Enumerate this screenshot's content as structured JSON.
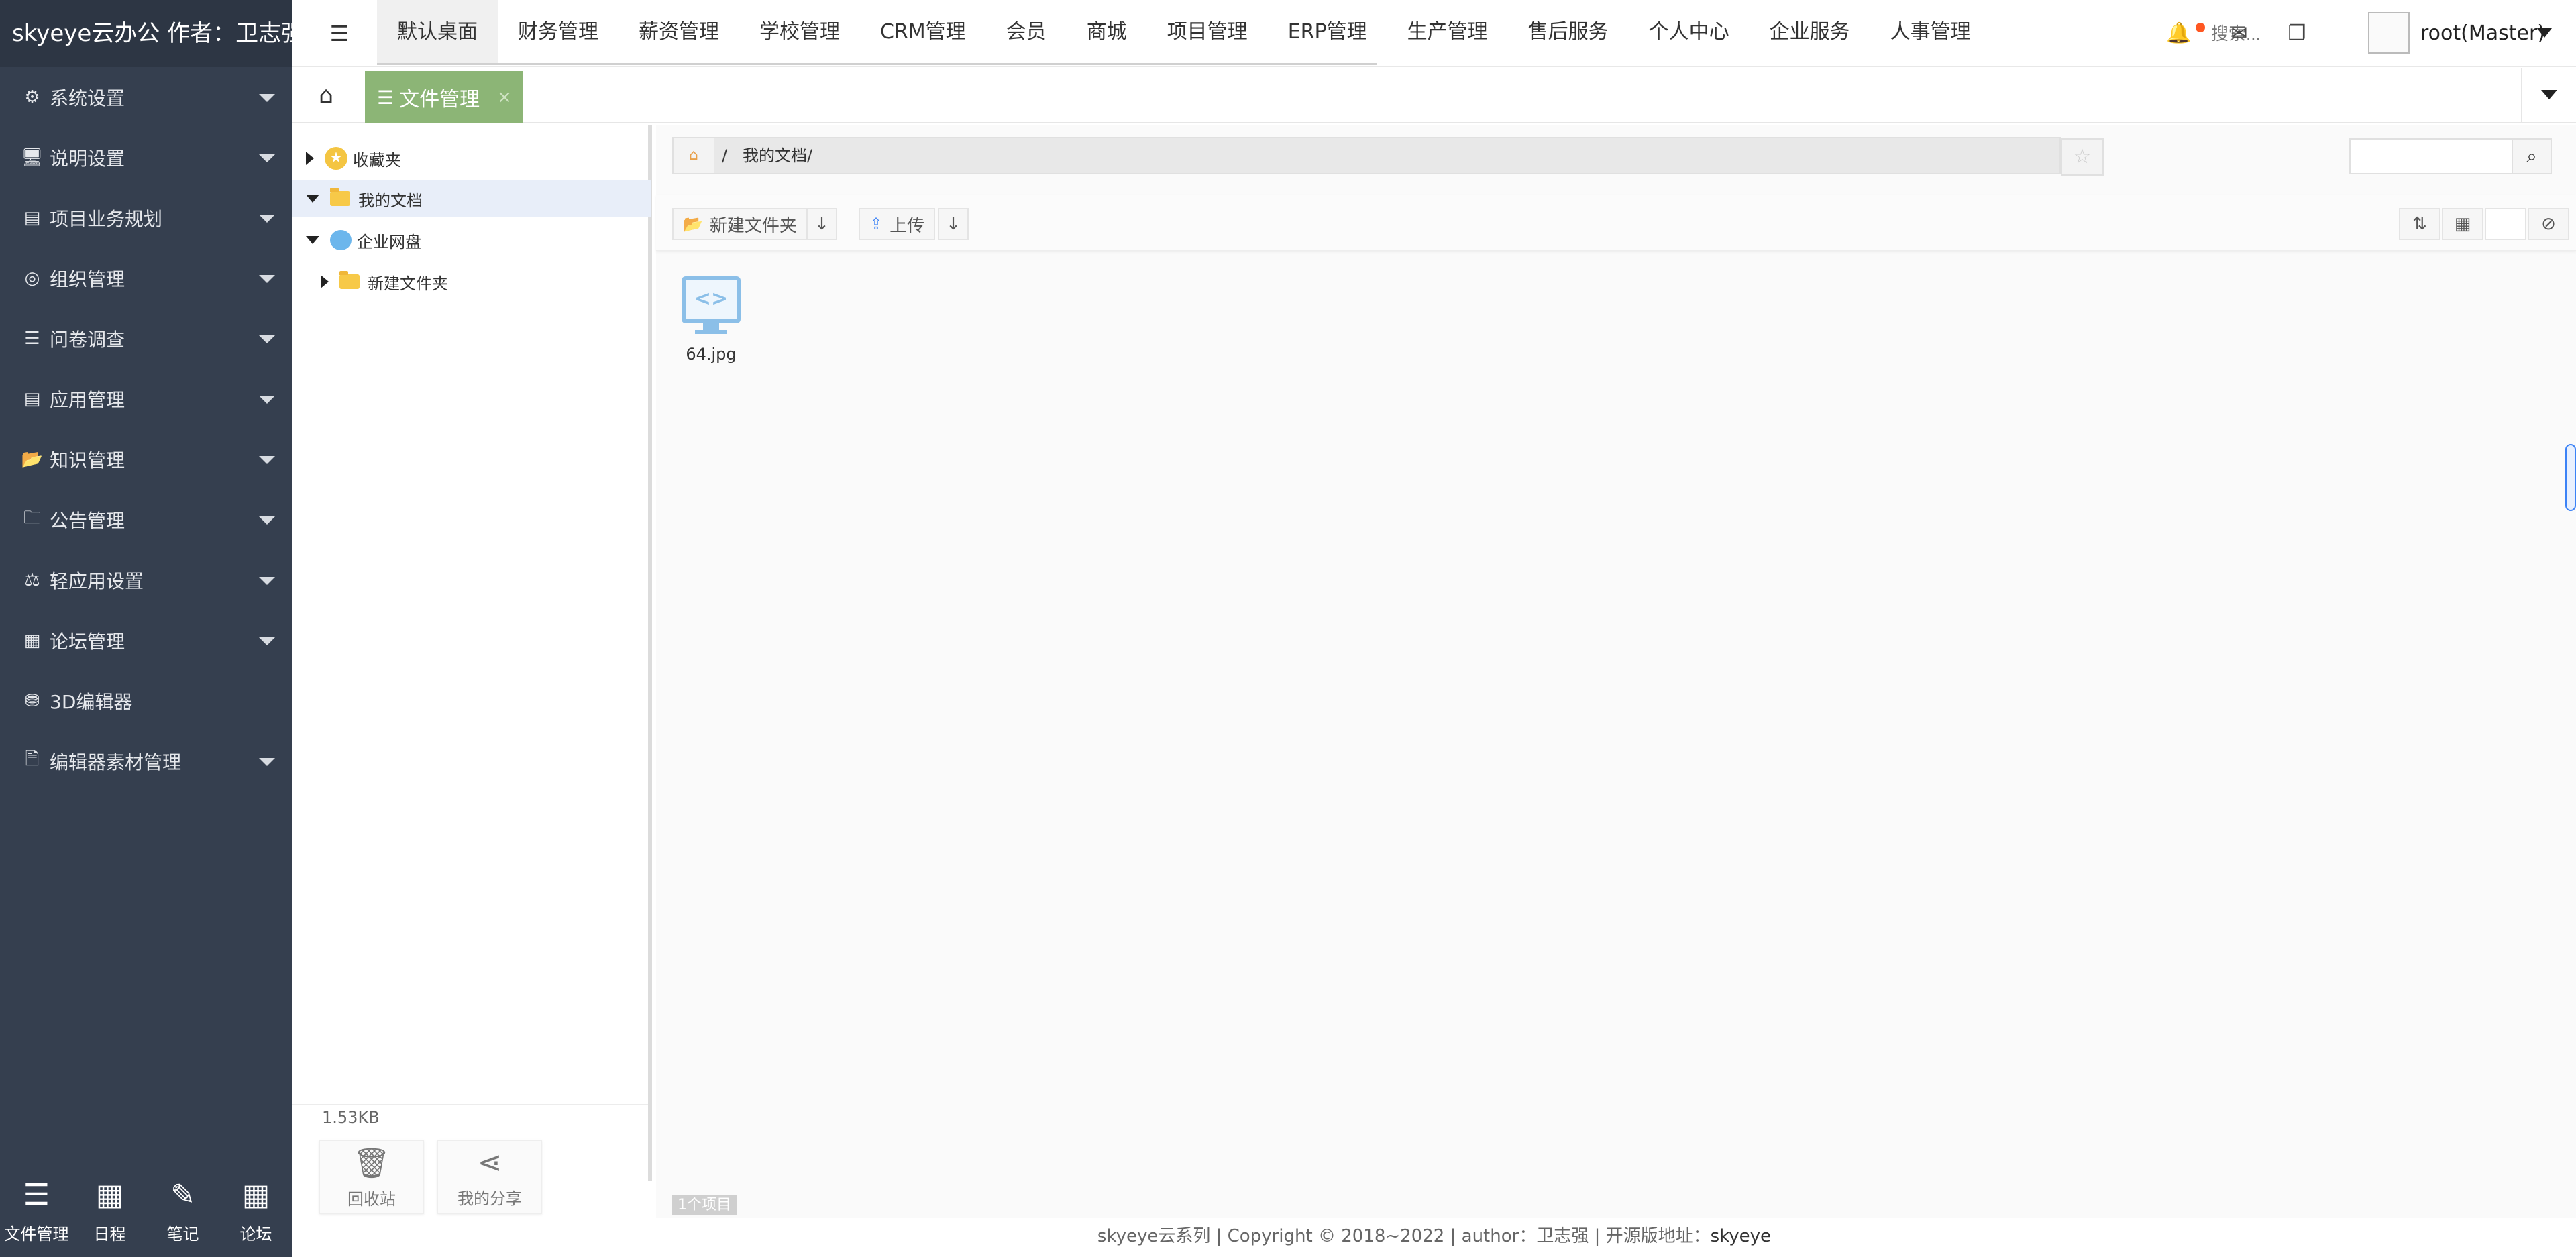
{
  "app": {
    "brand": "skyeye云办公 作者：卫志强"
  },
  "sidebar": {
    "items": [
      {
        "label": "系统设置",
        "icon": "gear-icon"
      },
      {
        "label": "说明设置",
        "icon": "monitor-icon"
      },
      {
        "label": "项目业务规划",
        "icon": "archive-icon"
      },
      {
        "label": "组织管理",
        "icon": "target-icon"
      },
      {
        "label": "问卷调查",
        "icon": "list-circle-icon"
      },
      {
        "label": "应用管理",
        "icon": "archive-icon"
      },
      {
        "label": "知识管理",
        "icon": "folder-open-icon"
      },
      {
        "label": "公告管理",
        "icon": "folder-icon"
      },
      {
        "label": "轻应用设置",
        "icon": "balance-scale-icon"
      },
      {
        "label": "论坛管理",
        "icon": "apps-plus-icon"
      },
      {
        "label": "3D编辑器",
        "icon": "cube-icon"
      },
      {
        "label": "编辑器素材管理",
        "icon": "file-icon"
      }
    ],
    "dock": [
      {
        "label": "文件管理",
        "icon": "list-icon"
      },
      {
        "label": "日程",
        "icon": "calendar-icon"
      },
      {
        "label": "笔记",
        "icon": "edit-icon"
      },
      {
        "label": "论坛",
        "icon": "calendar-icon"
      }
    ]
  },
  "topnav": {
    "items": [
      "默认桌面",
      "财务管理",
      "薪资管理",
      "学校管理",
      "CRM管理",
      "会员",
      "商城",
      "项目管理",
      "ERP管理",
      "生产管理",
      "售后服务",
      "个人中心",
      "企业服务",
      "人事管理"
    ],
    "active_index": 0,
    "search_placeholder": "搜索...",
    "user": "root(Master)"
  },
  "tabs": {
    "active": {
      "label": "文件管理",
      "close": "×"
    }
  },
  "tree": {
    "favorites": "收藏夹",
    "my_docs": "我的文档",
    "enterprise": "企业网盘",
    "new_folder": "新建文件夹",
    "size": "1.53KB",
    "recycle": "回收站",
    "share": "我的分享"
  },
  "main": {
    "path_root": "/",
    "path": "我的文档/",
    "new_folder_btn": "新建文件夹",
    "upload_btn": "上传",
    "file": {
      "name": "64.jpg"
    },
    "count": "1个项目"
  },
  "footer": {
    "text": "skyeye云系列 | Copyright © 2018~2022 | author：卫志强 | 开源版地址：",
    "link": "skyeye"
  }
}
